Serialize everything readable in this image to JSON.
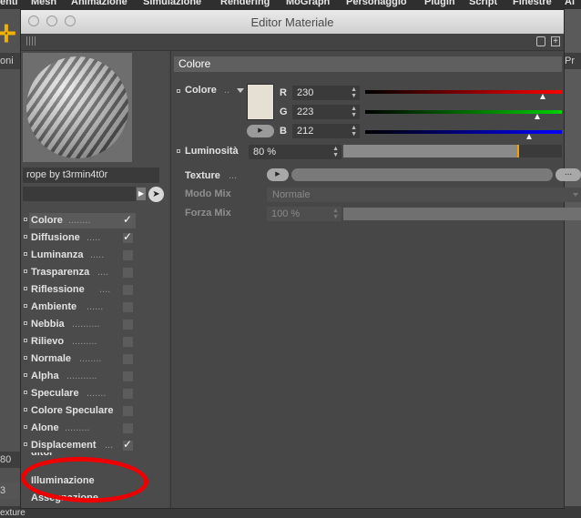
{
  "background_app": {
    "menubar": [
      "enti",
      "Mesh",
      "Animazione",
      "Simulazione",
      "Rendering",
      "MoGraph",
      "Personaggio",
      "Plugin",
      "Script",
      "Finestre",
      "Ai"
    ],
    "left_tab": "oni",
    "right_tab": "Pr",
    "frame_field": "80",
    "frame_field_2": "3",
    "bottom_label": "exture"
  },
  "window": {
    "title": "Editor Materiale"
  },
  "material": {
    "name": "rope by t3rmin4t0r"
  },
  "channels": [
    {
      "label": "Colore",
      "dots": "........",
      "checked": true,
      "selected": true
    },
    {
      "label": "Diffusione",
      "dots": ".....",
      "checked": true,
      "selected": false
    },
    {
      "label": "Luminanza",
      "dots": ".....",
      "checked": false,
      "selected": false
    },
    {
      "label": "Trasparenza",
      "dots": "....",
      "checked": false,
      "selected": false
    },
    {
      "label": "Riflessione",
      "dots": "....",
      "checked": false,
      "selected": false
    },
    {
      "label": "Ambiente",
      "dots": "......",
      "checked": false,
      "selected": false
    },
    {
      "label": "Nebbia",
      "dots": "..........",
      "checked": false,
      "selected": false
    },
    {
      "label": "Rilievo",
      "dots": ".........",
      "checked": false,
      "selected": false
    },
    {
      "label": "Normale",
      "dots": "........",
      "checked": false,
      "selected": false
    },
    {
      "label": "Alpha",
      "dots": "...........",
      "checked": false,
      "selected": false
    },
    {
      "label": "Speculare",
      "dots": ".......",
      "checked": false,
      "selected": false
    },
    {
      "label": "Colore Speculare",
      "dots": "",
      "checked": false,
      "selected": false
    },
    {
      "label": "Alone",
      "dots": ".........",
      "checked": false,
      "selected": false
    },
    {
      "label": "Displacement",
      "dots": "...",
      "checked": true,
      "selected": false
    }
  ],
  "extra_items": [
    "Illuminazione",
    "Assegnazione"
  ],
  "hidden_item_fragment": "ditor",
  "color_section": {
    "header": "Colore",
    "label": "Colore",
    "label_dots": "..",
    "swatch_color": "#e6dfd4",
    "r_label": "R",
    "r_value": "230",
    "g_label": "G",
    "g_value": "223",
    "b_label": "B",
    "b_value": "212"
  },
  "luminosity": {
    "label": "Luminosità",
    "value": "80 %",
    "level": 0.8
  },
  "texture": {
    "label": "Texture",
    "dots": "...",
    "more_button": "..."
  },
  "mix": {
    "mode_label": "Modo Mix",
    "mode_value": "Normale",
    "strength_label": "Forza Mix",
    "strength_value": "100 %"
  },
  "annotation_color": "#ee0000"
}
